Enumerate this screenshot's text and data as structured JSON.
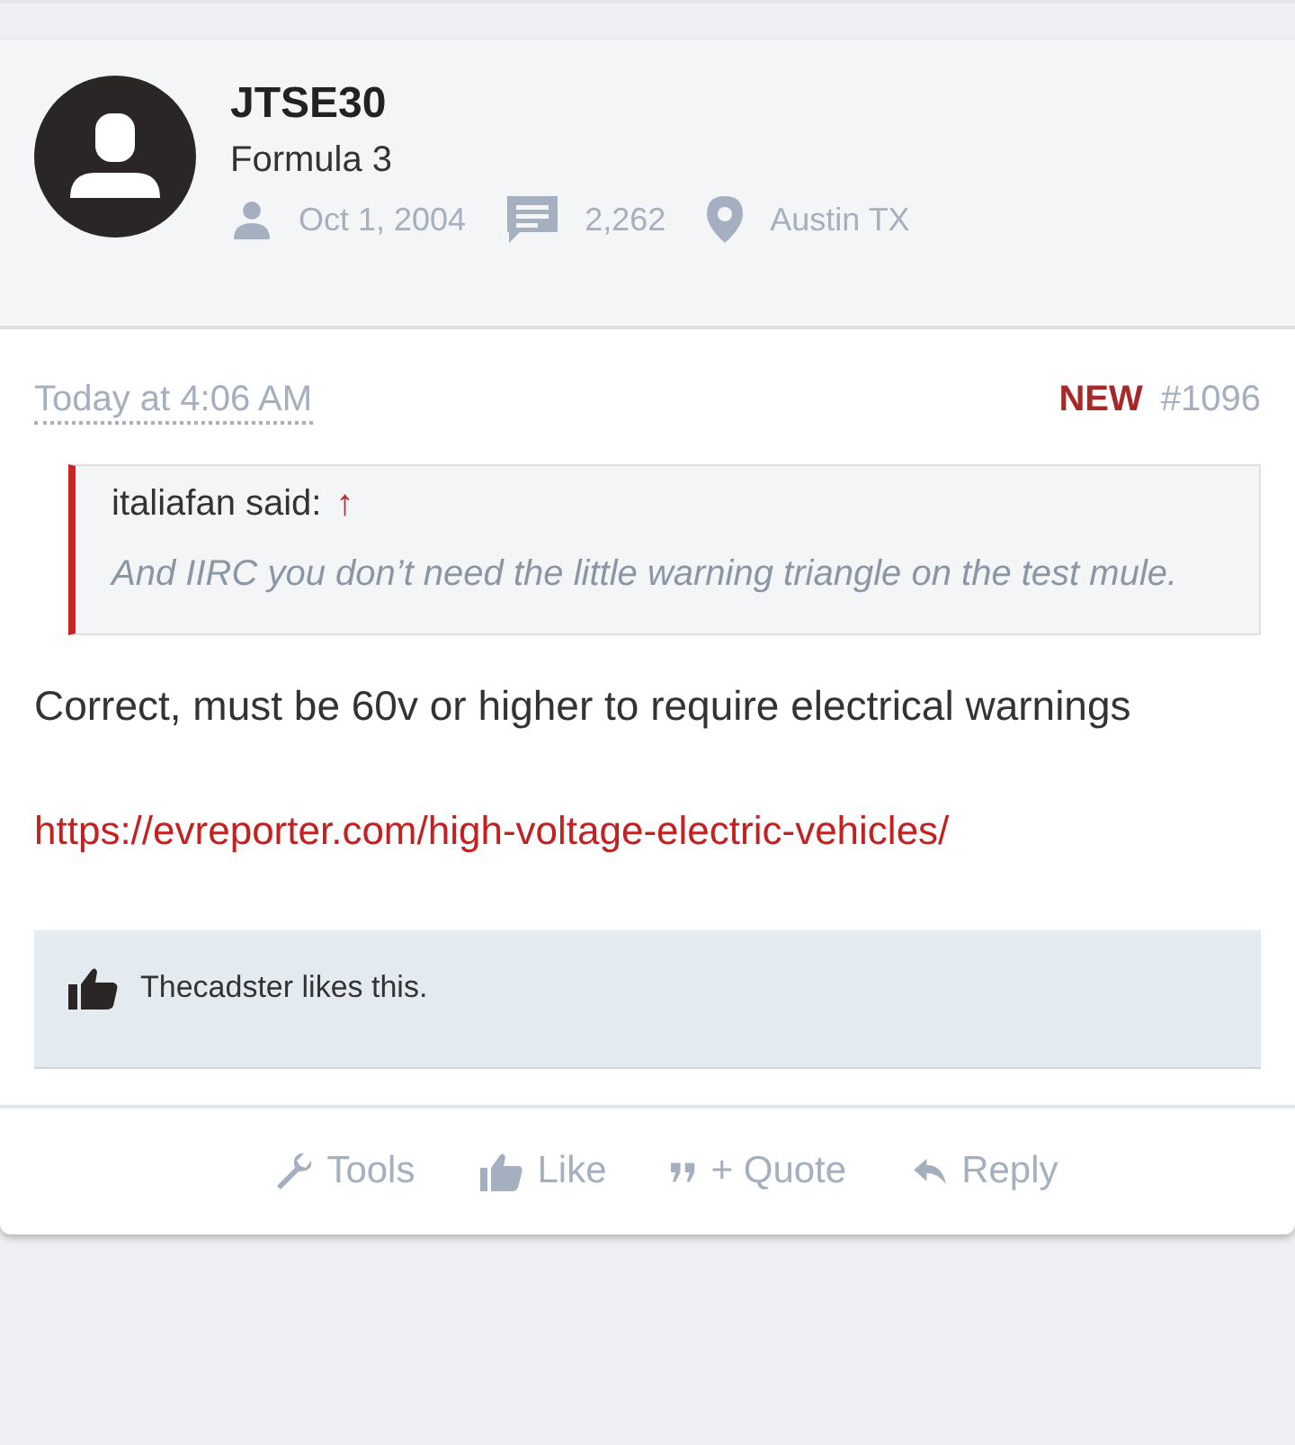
{
  "user": {
    "name": "JTSE30",
    "title": "Formula 3",
    "stats": [
      {
        "kind": "joined",
        "text": "Oct 1, 2004"
      },
      {
        "kind": "messages",
        "text": "2,262"
      },
      {
        "kind": "location",
        "text": "Austin TX"
      }
    ]
  },
  "post": {
    "time": "Today at 4:06 AM",
    "new_label": "NEW",
    "number": "#1096",
    "quote": {
      "author": "italiafan said:",
      "jump": "↑",
      "text": "And IIRC you don’t need the little warning triangle on the test mule."
    },
    "body": "Correct, must be 60v or higher to require electrical warnings",
    "link": "https://evreporter.com/high-voltage-electric-vehicles/",
    "likes": "Thecadster likes this."
  },
  "actions": [
    {
      "kind": "tools",
      "label": "Tools"
    },
    {
      "kind": "like",
      "label": "Like"
    },
    {
      "kind": "quote",
      "label": "+ Quote"
    },
    {
      "kind": "reply",
      "label": "Reply"
    }
  ]
}
